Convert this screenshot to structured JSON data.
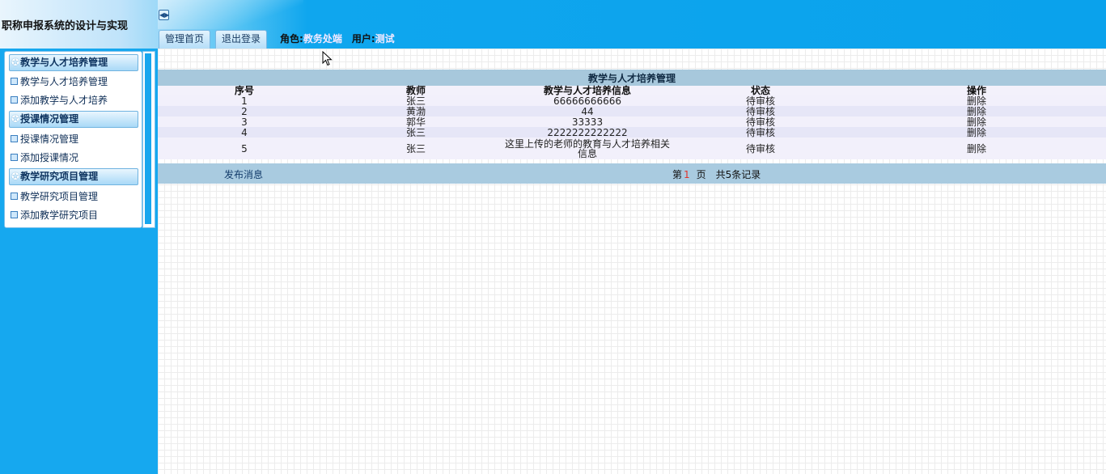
{
  "header": {
    "app_title": "职称申报系统的设计与实现",
    "collapse_icon": "toggle-arrows-icon",
    "tabs": [
      {
        "label": "管理首页"
      },
      {
        "label": "退出登录"
      }
    ],
    "role_label": "角色:",
    "role_value": "教务处端",
    "user_label": "用户:",
    "user_value": "测试"
  },
  "sidebar": {
    "sections": [
      {
        "title": "教学与人才培养管理",
        "items": [
          "教学与人才培养管理",
          "添加教学与人才培养"
        ]
      },
      {
        "title": "授课情况管理",
        "items": [
          "授课情况管理",
          "添加授课情况"
        ]
      },
      {
        "title": "教学研究项目管理",
        "items": [
          "教学研究项目管理",
          "添加教学研究项目"
        ]
      }
    ]
  },
  "table": {
    "caption": "教学与人才培养管理",
    "columns": [
      "序号",
      "教师",
      "教学与人才培养信息",
      "状态",
      "操作"
    ],
    "rows": [
      {
        "no": "1",
        "teacher": "张三",
        "info": "66666666666",
        "status": "待审核",
        "action": "删除"
      },
      {
        "no": "2",
        "teacher": "黄渤",
        "info": "44",
        "status": "待审核",
        "action": "删除"
      },
      {
        "no": "3",
        "teacher": "郭华",
        "info": "33333",
        "status": "待审核",
        "action": "删除"
      },
      {
        "no": "4",
        "teacher": "张三",
        "info": "2222222222222",
        "status": "待审核",
        "action": "删除"
      },
      {
        "no": "5",
        "teacher": "张三",
        "info_line1": "这里上传的老师的教育与人才培养相关",
        "info_line2": "信息",
        "status": "待审核",
        "action": "删除"
      }
    ]
  },
  "footer": {
    "publish_label": "发布消息",
    "pager_prefix": "第",
    "current_page": "1",
    "pager_page_word": "页",
    "pager_total": "共5条记录"
  },
  "colors": {
    "header_blue": "#0aa2ec",
    "sidebar_blue": "#16a8ef",
    "table_caption_bg": "#a7c8dc",
    "page_number_red": "#e0342b"
  }
}
